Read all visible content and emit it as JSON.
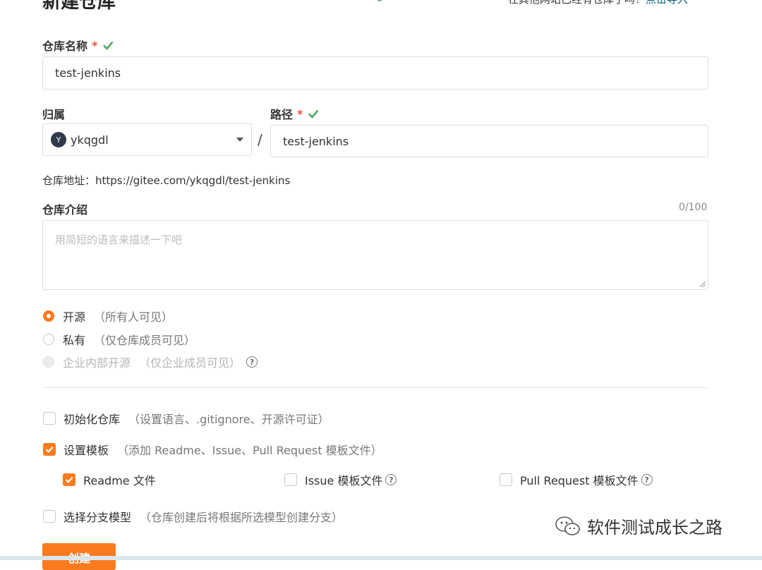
{
  "page": {
    "title": "新建仓库",
    "top_hint": "在其他网站已经有仓库了吗？",
    "top_hint_link": "点击导入"
  },
  "repo_name": {
    "label": "仓库名称",
    "required_mark": "*",
    "value": "test-jenkins"
  },
  "owner": {
    "label": "归属",
    "avatar_letter": "Y",
    "value": "ykqgdl"
  },
  "path_sep": "/",
  "path": {
    "label": "路径",
    "required_mark": "*",
    "value": "test-jenkins"
  },
  "address": {
    "label": "仓库地址：",
    "value": "https://gitee.com/ykqgdl/test-jenkins"
  },
  "intro": {
    "label": "仓库介绍",
    "counter": "0/100",
    "placeholder": "用简短的语言来描述一下吧"
  },
  "visibility": {
    "options": [
      {
        "label": "开源",
        "hint": "（所有人可见）",
        "selected": true,
        "disabled": false
      },
      {
        "label": "私有",
        "hint": "（仅仓库成员可见）",
        "selected": false,
        "disabled": false
      },
      {
        "label": "企业内部开源",
        "hint": "（仅企业成员可见）",
        "selected": false,
        "disabled": true
      }
    ]
  },
  "init_repo": {
    "label": "初始化仓库",
    "hint": "（设置语言、.gitignore、开源许可证）",
    "checked": false
  },
  "set_template": {
    "label": "设置模板",
    "hint": "（添加 Readme、Issue、Pull Request 模板文件）",
    "checked": true
  },
  "templates": [
    {
      "label": "Readme 文件",
      "checked": true,
      "help": false
    },
    {
      "label": "Issue 模板文件",
      "checked": false,
      "help": true
    },
    {
      "label": "Pull Request 模板文件",
      "checked": false,
      "help": true
    }
  ],
  "branch_model": {
    "label": "选择分支模型",
    "hint": "（仓库创建后将根据所选模型创建分支）",
    "checked": false
  },
  "create_button": "创建",
  "watermark": "软件测试成长之路",
  "help_glyph": "?",
  "colors": {
    "accent": "#fa7a1e",
    "valid": "#3fa34d",
    "required": "#e5533d"
  }
}
